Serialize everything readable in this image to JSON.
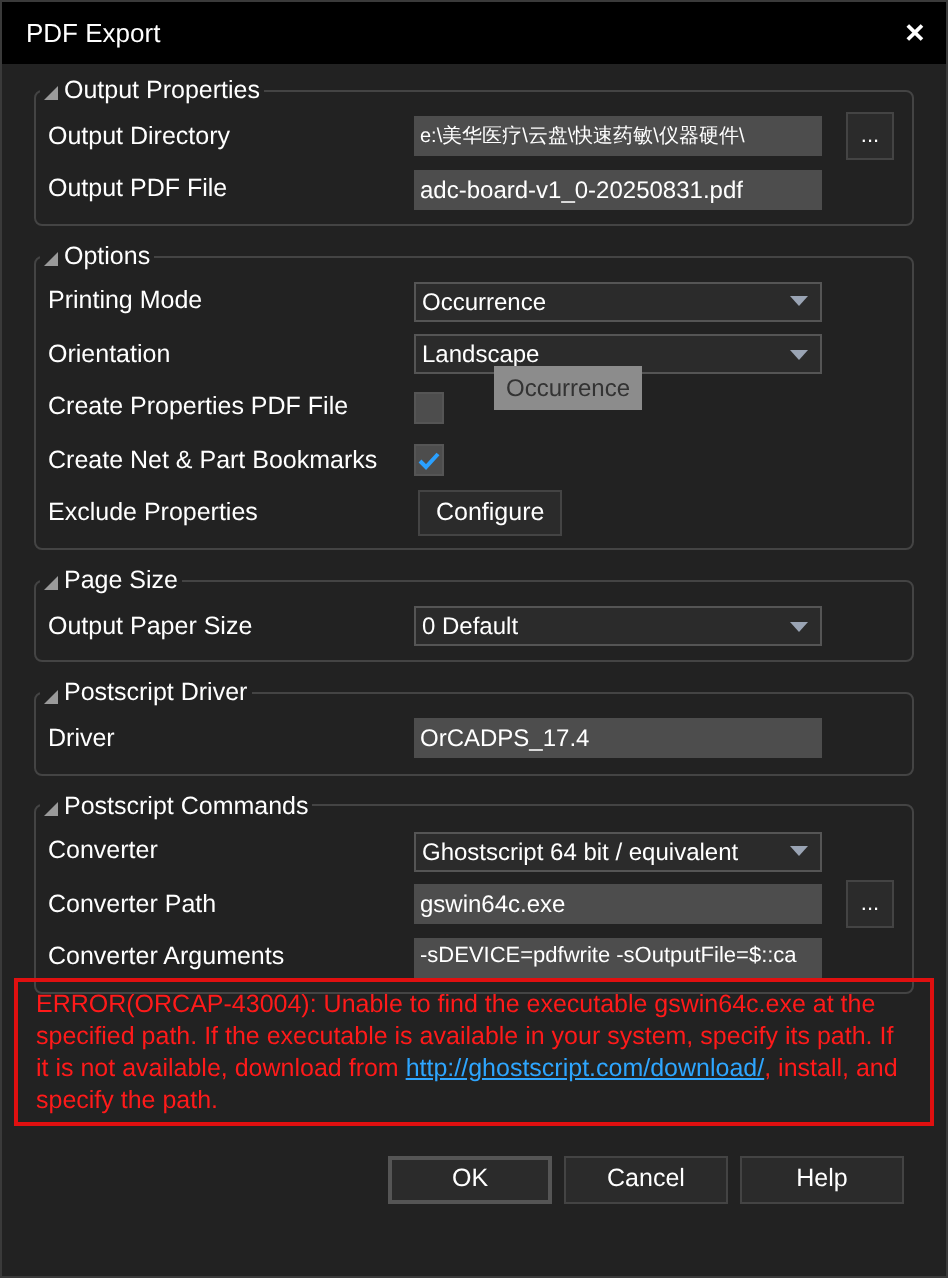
{
  "window": {
    "title": "PDF Export",
    "close": "✕"
  },
  "sections": [
    {
      "title": "Output Properties",
      "rows": [
        {
          "label": "Output Directory",
          "kind": "text",
          "value": "e:\\美华医疗\\云盘\\快速药敏\\仪器硬件\\",
          "browse": "..."
        },
        {
          "label": "Output PDF File",
          "kind": "text",
          "value": "adc-board-v1_0-20250831.pdf"
        }
      ]
    },
    {
      "title": "Options",
      "rows": [
        {
          "label": "Printing Mode",
          "kind": "select",
          "value": "Occurrence"
        },
        {
          "label": "Orientation",
          "kind": "select",
          "value": "Landscape",
          "tooltip": "Occurrence"
        },
        {
          "label": "Create Properties PDF File",
          "kind": "checkbox",
          "checked": false
        },
        {
          "label": "Create Net & Part Bookmarks",
          "kind": "checkbox",
          "checked": true
        },
        {
          "label": "Exclude Properties",
          "kind": "button",
          "value": "Configure"
        }
      ]
    },
    {
      "title": "Page Size",
      "rows": [
        {
          "label": "Output Paper Size",
          "kind": "select",
          "value": "0 Default"
        }
      ]
    },
    {
      "title": "Postscript Driver",
      "rows": [
        {
          "label": "Driver",
          "kind": "text",
          "value": "OrCADPS_17.4"
        }
      ]
    },
    {
      "title": "Postscript Commands",
      "rows": [
        {
          "label": "Converter",
          "kind": "select",
          "value": "Ghostscript 64 bit / equivalent"
        },
        {
          "label": "Converter Path",
          "kind": "text",
          "value": "gswin64c.exe",
          "browse": "..."
        },
        {
          "label": "Converter Arguments",
          "kind": "text",
          "value": "-sDEVICE=pdfwrite -sOutputFile=$::ca"
        }
      ]
    }
  ],
  "error": {
    "text_before": "ERROR(ORCAP-43004): Unable to find the executable gswin64c.exe at the specified path. If the executable is available in your system, specify its path. If it is not available, download from ",
    "link": "http://ghostscript.com/download/",
    "text_after": ", install, and specify the path."
  },
  "buttons": [
    "OK",
    "Cancel",
    "Help"
  ]
}
